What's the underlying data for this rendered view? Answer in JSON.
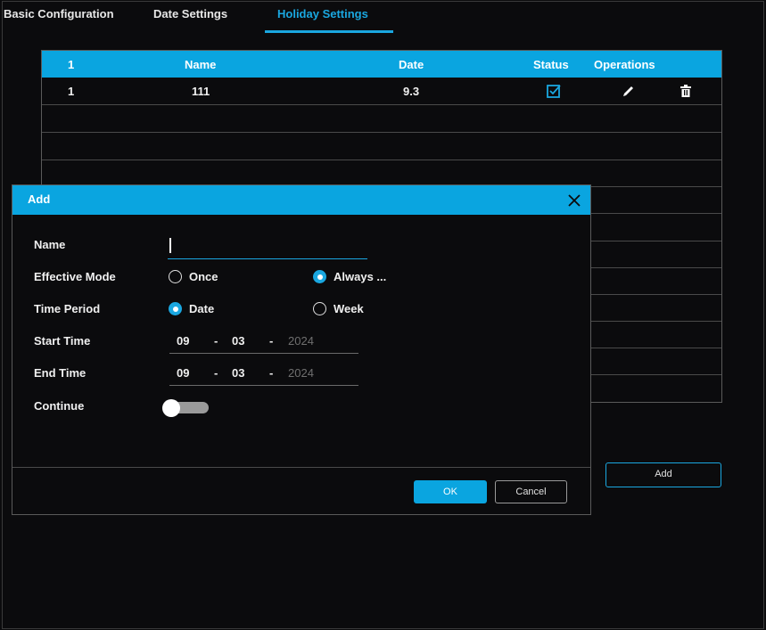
{
  "tabs": [
    {
      "label": "Basic Configuration"
    },
    {
      "label": "Date Settings"
    },
    {
      "label": "Holiday Settings",
      "active": true
    }
  ],
  "table": {
    "headers": [
      "1",
      "Name",
      "Date",
      "Status",
      "Operations"
    ],
    "rows": [
      {
        "index": "1",
        "name": "111",
        "date": "9.3",
        "status_checked": true,
        "edit_icon": "pencil-icon",
        "delete_icon": "trash-icon"
      }
    ]
  },
  "add_button": "Add",
  "dialog": {
    "title": "Add",
    "close_icon": "close-icon",
    "name_label": "Name",
    "name_value": "",
    "effective_mode_label": "Effective Mode",
    "effective_mode_options": [
      "Once",
      "Always ..."
    ],
    "effective_mode_selected": "Always ...",
    "time_period_label": "Time Period",
    "time_period_options": [
      "Date",
      "Week"
    ],
    "time_period_selected": "Date",
    "start_time_label": "Start Time",
    "start_time": {
      "month": "09",
      "day": "03",
      "year": "2024"
    },
    "end_time_label": "End Time",
    "end_time": {
      "month": "09",
      "day": "03",
      "year": "2024"
    },
    "date_separator": "-",
    "continue_label": "Continue",
    "continue_on": false,
    "ok_label": "OK",
    "cancel_label": "Cancel"
  },
  "colors": {
    "accent": "#0aa5e0",
    "background": "#0b0b0d"
  }
}
